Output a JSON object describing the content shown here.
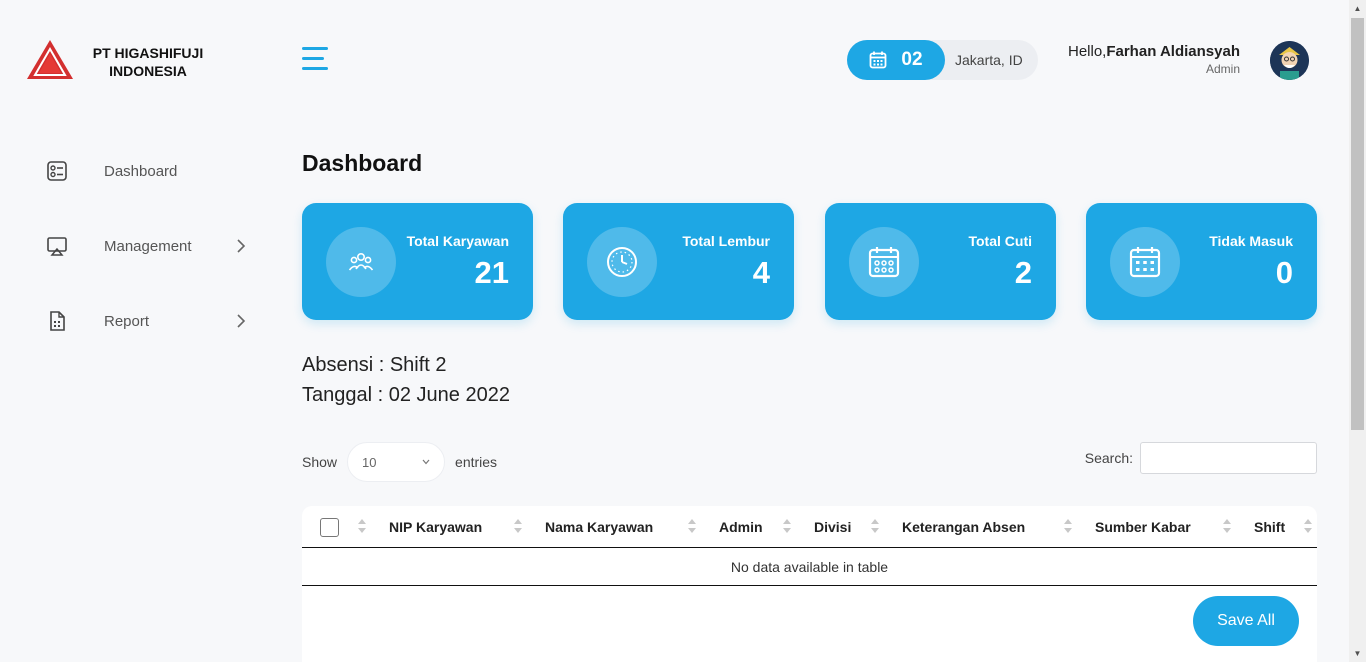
{
  "brand": {
    "company_line1": "PT HIGASHIFUJI",
    "company_line2": "INDONESIA"
  },
  "header": {
    "date_day": "02",
    "location": "Jakarta, ID",
    "greeting": "Hello,",
    "user_name": "Farhan Aldiansyah",
    "user_role": "Admin"
  },
  "sidebar": {
    "items": [
      {
        "label": "Dashboard",
        "icon": "dashboard-icon"
      },
      {
        "label": "Management",
        "icon": "monitor-icon"
      },
      {
        "label": "Report",
        "icon": "report-icon"
      }
    ]
  },
  "main": {
    "title": "Dashboard",
    "cards": [
      {
        "title": "Total Karyawan",
        "value": "21",
        "icon": "users-icon"
      },
      {
        "title": "Total Lembur",
        "value": "4",
        "icon": "clock-icon"
      },
      {
        "title": "Total Cuti",
        "value": "2",
        "icon": "calendar-icon"
      },
      {
        "title": "Tidak Masuk",
        "value": "0",
        "icon": "calendar-icon"
      }
    ],
    "absensi": "Absensi : Shift 2",
    "tanggal": "Tanggal : 02 June 2022"
  },
  "table": {
    "show_label": "Show",
    "entries_value": "10",
    "entries_label": "entries",
    "search_label": "Search:",
    "search_value": "",
    "columns": [
      "NIP Karyawan",
      "Nama Karyawan",
      "Admin",
      "Divisi",
      "Keterangan Absen",
      "Sumber Kabar",
      "Shift"
    ],
    "empty_message": "No data available in table",
    "save_label": "Save All"
  },
  "colors": {
    "accent": "#1ea7e4",
    "background": "#f7f8fa",
    "logo_red": "#d32f2f"
  }
}
